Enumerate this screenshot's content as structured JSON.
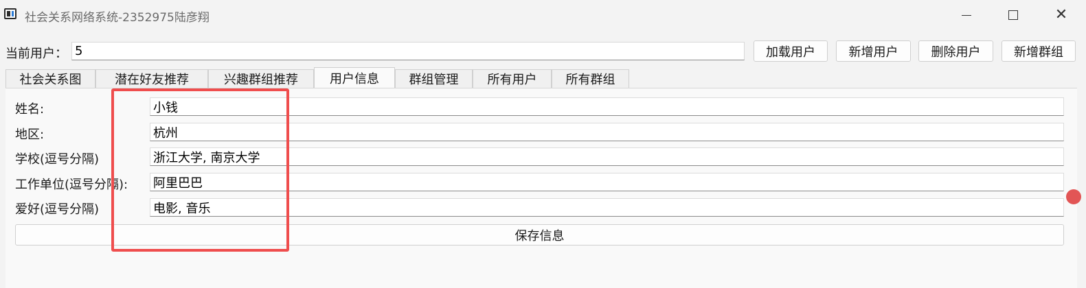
{
  "window": {
    "title": "社会关系网络系统-2352975陆彦翔",
    "icons": {
      "app": "app-icon",
      "minimize": "minimize-icon",
      "maximize": "maximize-icon",
      "close": "close-icon"
    }
  },
  "toolbar": {
    "current_user_label": "当前用户：",
    "current_user_value": "5",
    "load_user": "加载用户",
    "add_user": "新增用户",
    "delete_user": "删除用户",
    "add_group": "新增群组"
  },
  "tabs": [
    {
      "label": "社会关系图"
    },
    {
      "label": "潜在好友推荐"
    },
    {
      "label": "兴趣群组推荐"
    },
    {
      "label": "用户信息",
      "active": true
    },
    {
      "label": "群组管理"
    },
    {
      "label": "所有用户"
    },
    {
      "label": "所有群组"
    }
  ],
  "user_info": {
    "name_label": "姓名:",
    "name_value": "小钱",
    "region_label": "地区:",
    "region_value": "杭州",
    "school_label": "学校(逗号分隔)",
    "school_value": "浙江大学, 南京大学",
    "work_label": "工作单位(逗号分隔):",
    "work_value": "阿里巴巴",
    "hobby_label": "爱好(逗号分隔)",
    "hobby_value": "电影, 音乐",
    "save_button": "保存信息"
  },
  "colors": {
    "highlight": "#ef4d4d",
    "window_bg": "#f3f3f3"
  }
}
